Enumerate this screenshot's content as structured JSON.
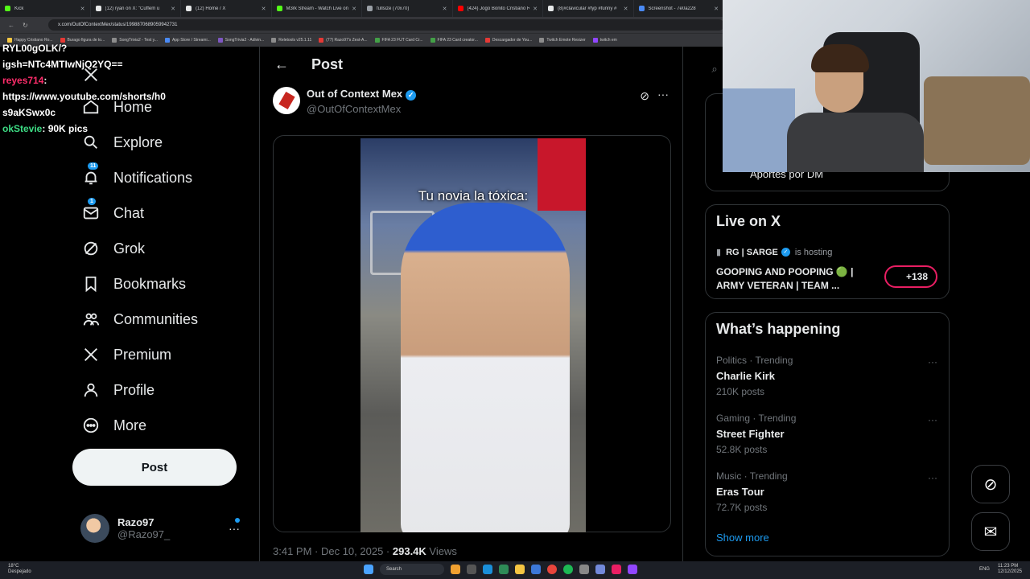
{
  "browser": {
    "tabs": [
      {
        "title": "Kick",
        "color": "#53fc18"
      },
      {
        "title": "(12) ryan on X: \"Cuffem u",
        "color": "#e7e9ea"
      },
      {
        "title": "(12) Home / X",
        "color": "#e7e9ea"
      },
      {
        "title": "M3rk Stream - Watch Live on",
        "color": "#53fc18"
      },
      {
        "title": "fullsize (70x70)",
        "color": "#9aa0a6"
      },
      {
        "title": "(424) Jogo Bonito Cristiano R",
        "color": "#ff0000"
      },
      {
        "title": "(8)#clavicular #fyp #funny #",
        "color": "#e7e9ea"
      },
      {
        "title": "Screenshot - 7e0a228",
        "color": "#4a8af4"
      }
    ],
    "url": "x.com/OutOfContextMex/status/1998870689059942731",
    "bookmarks": [
      {
        "label": "Happy Cristiano Ro...",
        "color": "#f7c843"
      },
      {
        "label": "Burago figura de to...",
        "color": "#e53935"
      },
      {
        "label": "SongTrivia2 - Test y...",
        "color": "#8c8c8c"
      },
      {
        "label": "App Store / Streami...",
        "color": "#4a8af4"
      },
      {
        "label": "SongTrivia2 - Adivin...",
        "color": "#7e57c2"
      },
      {
        "label": "Reletools v25.1.11",
        "color": "#8c8c8c"
      },
      {
        "label": "(77) Razo97's Zest-A...",
        "color": "#e53935"
      },
      {
        "label": "FIFA 23 FUT Card Cr...",
        "color": "#43a047"
      },
      {
        "label": "FIFA 23 Card creator...",
        "color": "#43a047"
      },
      {
        "label": "Descargador de You...",
        "color": "#e53935"
      },
      {
        "label": "Twitch Emote Resizer",
        "color": "#8c8c8c"
      },
      {
        "label": "twitch em",
        "color": "#9146ff"
      }
    ]
  },
  "chat_overlay": {
    "lines": [
      {
        "user": "",
        "text": "RYL00gOLK/?"
      },
      {
        "user": "",
        "text": "igsh=NTc4MTIwNjQ2YQ=="
      },
      {
        "user": "reyes714",
        "text": ":"
      },
      {
        "user": "",
        "text": "https://www.youtube.com/shorts/h0"
      },
      {
        "user": "",
        "text": "s9aKSwx0c"
      },
      {
        "user": "okStevie",
        "text": ": 90K pics"
      }
    ],
    "user_colors": {
      "reyes714": "#ff2d6b",
      "okStevie": "#3ddc84"
    }
  },
  "nav": {
    "items": [
      {
        "label": "Home",
        "icon": "home-icon",
        "badge": ""
      },
      {
        "label": "Explore",
        "icon": "search-icon",
        "badge": ""
      },
      {
        "label": "Notifications",
        "icon": "bell-icon",
        "badge": "11"
      },
      {
        "label": "Chat",
        "icon": "mail-icon",
        "badge": "1"
      },
      {
        "label": "Grok",
        "icon": "grok-icon",
        "badge": ""
      },
      {
        "label": "Bookmarks",
        "icon": "bookmark-icon",
        "badge": ""
      },
      {
        "label": "Communities",
        "icon": "people-icon",
        "badge": ""
      },
      {
        "label": "Premium",
        "icon": "x-logo-icon",
        "badge": ""
      },
      {
        "label": "Profile",
        "icon": "person-icon",
        "badge": ""
      },
      {
        "label": "More",
        "icon": "more-circle-icon",
        "badge": ""
      }
    ],
    "post_button": "Post",
    "account": {
      "name": "Razo97",
      "handle": "@Razo97_"
    }
  },
  "post": {
    "header": "Post",
    "author_name": "Out of Context Mex",
    "author_handle": "@OutOfContextMex",
    "video_caption": "Tu novia la tóxica:",
    "time": "3:41 PM · Dec 10, 2025 ·",
    "views_count": "293.4K",
    "views_label": "Views"
  },
  "right": {
    "top_card_partial": "Aportes por DM",
    "live": {
      "title": "Live on X",
      "host": "RG | SARGE",
      "hosting_label": "is hosting",
      "stream_title": "GOOPING AND POOPING 🟢 | ARMY VETERAN | TEAM ...",
      "listeners": "+138"
    },
    "happening": {
      "title": "What’s happening",
      "trends": [
        {
          "category": "Politics · Trending",
          "name": "Charlie Kirk",
          "count": "210K posts"
        },
        {
          "category": "Gaming · Trending",
          "name": "Street Fighter",
          "count": "52.8K posts"
        },
        {
          "category": "Music · Trending",
          "name": "Eras Tour",
          "count": "72.7K posts"
        }
      ],
      "show_more": "Show more"
    }
  },
  "taskbar": {
    "weather_temp": "18°C",
    "weather_desc": "Despejado",
    "search_label": "Search",
    "lang": "ENG",
    "time": "11:23 PM",
    "date": "12/12/2025"
  },
  "colors": {
    "accent": "#1d9bf0",
    "live_ring": "#e91e63",
    "background": "#000000"
  }
}
